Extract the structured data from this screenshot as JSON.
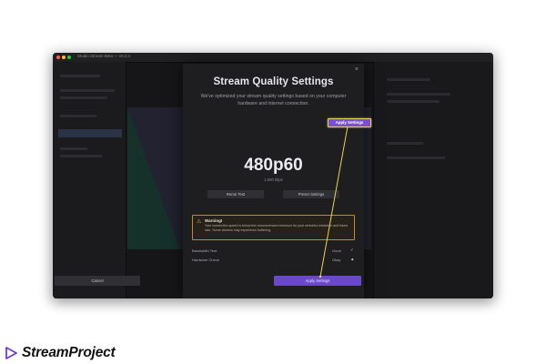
{
  "window": {
    "title": "Studio Stream Beta — v0.3.1"
  },
  "modal": {
    "title": "Stream Quality Settings",
    "description": "We've optimized your stream quality settings based on your computer hardware and internet connection.",
    "close_glyph": "×",
    "resolution": "480p60",
    "bitrate": "1,500 kbps",
    "run_test_label": "Rerun Test",
    "preset_label": "Preset Settings",
    "warning": {
      "title": "Warning!",
      "text": "Your connection speed is below the recommended minimum for your selected resolution and frame rate. Some viewers may experience buffering."
    },
    "options": [
      {
        "label": "Bandwidth Test",
        "value": "Good"
      },
      {
        "label": "Hardware Check",
        "value": "Okay"
      }
    ],
    "cancel_label": "Cancel",
    "apply_label": "Apply Settings"
  },
  "callout": {
    "label": "Apply Settings"
  },
  "brand": {
    "name": "StreamProject"
  },
  "colors": {
    "accent": "#6a48c8",
    "callout_border": "#e8d44b",
    "warning_border": "#c48a1e",
    "brand_icon": "#6b3fd6"
  },
  "icons": {
    "close": "close-icon",
    "warning": "warning-icon",
    "option_ok": "check-icon",
    "option_warn": "caution-icon",
    "brand": "play-triangle-icon"
  }
}
